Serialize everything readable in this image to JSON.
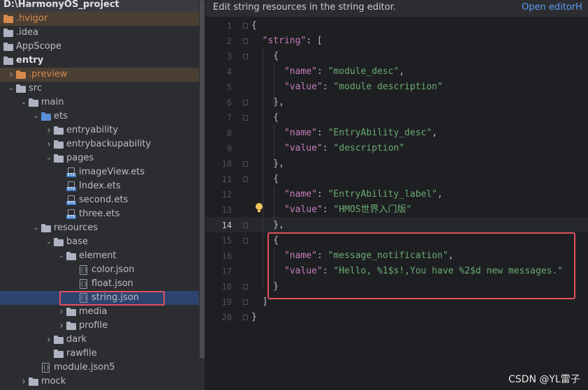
{
  "tree": {
    "project_root": "D:\\HarmonyOS_project",
    "items": [
      {
        "label": "D:\\HarmonyOS_project",
        "depth": 0,
        "kind": "root",
        "chev": ""
      },
      {
        "label": ".hvigor",
        "depth": 0,
        "kind": "folder",
        "chev": ""
      },
      {
        "label": ".idea",
        "depth": 0,
        "kind": "folder",
        "chev": ""
      },
      {
        "label": "AppScope",
        "depth": 0,
        "kind": "folder",
        "chev": ""
      },
      {
        "label": "entry",
        "depth": 0,
        "kind": "folder",
        "chev": ""
      },
      {
        "label": ".preview",
        "depth": 1,
        "kind": "folder",
        "chev": "right"
      },
      {
        "label": "src",
        "depth": 1,
        "kind": "folder",
        "chev": "down"
      },
      {
        "label": "main",
        "depth": 2,
        "kind": "folder",
        "chev": "down"
      },
      {
        "label": "ets",
        "depth": 3,
        "kind": "folder",
        "chev": "down"
      },
      {
        "label": "entryability",
        "depth": 4,
        "kind": "folder",
        "chev": "right"
      },
      {
        "label": "entrybackupability",
        "depth": 4,
        "kind": "folder",
        "chev": "right"
      },
      {
        "label": "pages",
        "depth": 4,
        "kind": "folder",
        "chev": "down"
      },
      {
        "label": "imageView.ets",
        "depth": 5,
        "kind": "ets",
        "chev": ""
      },
      {
        "label": "Index.ets",
        "depth": 5,
        "kind": "ets",
        "chev": ""
      },
      {
        "label": "second.ets",
        "depth": 5,
        "kind": "ets",
        "chev": ""
      },
      {
        "label": "three.ets",
        "depth": 5,
        "kind": "ets",
        "chev": ""
      },
      {
        "label": "resources",
        "depth": 3,
        "kind": "folder",
        "chev": "down"
      },
      {
        "label": "base",
        "depth": 4,
        "kind": "folder",
        "chev": "down"
      },
      {
        "label": "element",
        "depth": 5,
        "kind": "folder",
        "chev": "down"
      },
      {
        "label": "color.json",
        "depth": 6,
        "kind": "json",
        "chev": ""
      },
      {
        "label": "float.json",
        "depth": 6,
        "kind": "json",
        "chev": ""
      },
      {
        "label": "string.json",
        "depth": 6,
        "kind": "json",
        "chev": ""
      },
      {
        "label": "media",
        "depth": 5,
        "kind": "folder",
        "chev": "right"
      },
      {
        "label": "profile",
        "depth": 5,
        "kind": "folder",
        "chev": "right"
      },
      {
        "label": "dark",
        "depth": 4,
        "kind": "folder",
        "chev": "right"
      },
      {
        "label": "rawfile",
        "depth": 4,
        "kind": "folder",
        "chev": ""
      },
      {
        "label": "module.json5",
        "depth": 3,
        "kind": "json",
        "chev": ""
      },
      {
        "label": "mock",
        "depth": 2,
        "kind": "folder",
        "chev": "right"
      }
    ]
  },
  "banner": {
    "text": "Edit string resources in the string editor.",
    "open_editor": "Open editor",
    "hide": "H"
  },
  "editor": {
    "current_line": 14,
    "line_numbers": [
      "1",
      "2",
      "3",
      "4",
      "5",
      "6",
      "7",
      "8",
      "9",
      "10",
      "11",
      "12",
      "13",
      "14",
      "15",
      "16",
      "17",
      "18",
      "19",
      "20"
    ],
    "lines": [
      [
        [
          "p",
          "{"
        ]
      ],
      [
        [
          "p",
          "  "
        ],
        [
          "k",
          "\"string\""
        ],
        [
          "p",
          ": ["
        ]
      ],
      [
        [
          "p",
          "    {"
        ]
      ],
      [
        [
          "p",
          "      "
        ],
        [
          "k",
          "\"name\""
        ],
        [
          "p",
          ": "
        ],
        [
          "s",
          "\"module_desc\""
        ],
        [
          "p",
          ","
        ]
      ],
      [
        [
          "p",
          "      "
        ],
        [
          "k",
          "\"value\""
        ],
        [
          "p",
          ": "
        ],
        [
          "s",
          "\"module description\""
        ]
      ],
      [
        [
          "p",
          "    },"
        ]
      ],
      [
        [
          "p",
          "    {"
        ]
      ],
      [
        [
          "p",
          "      "
        ],
        [
          "k",
          "\"name\""
        ],
        [
          "p",
          ": "
        ],
        [
          "s",
          "\"EntryAbility_desc\""
        ],
        [
          "p",
          ","
        ]
      ],
      [
        [
          "p",
          "      "
        ],
        [
          "k",
          "\"value\""
        ],
        [
          "p",
          ": "
        ],
        [
          "s",
          "\"description\""
        ]
      ],
      [
        [
          "p",
          "    },"
        ]
      ],
      [
        [
          "p",
          "    {"
        ]
      ],
      [
        [
          "p",
          "      "
        ],
        [
          "k",
          "\"name\""
        ],
        [
          "p",
          ": "
        ],
        [
          "s",
          "\"EntryAbility_label\""
        ],
        [
          "p",
          ","
        ]
      ],
      [
        [
          "p",
          "      "
        ],
        [
          "k",
          "\"value\""
        ],
        [
          "p",
          ": "
        ],
        [
          "s",
          "\"HMOS世界入门版\""
        ]
      ],
      [
        [
          "p",
          "    },"
        ]
      ],
      [
        [
          "p",
          "    {"
        ]
      ],
      [
        [
          "p",
          "      "
        ],
        [
          "k",
          "\"name\""
        ],
        [
          "p",
          ": "
        ],
        [
          "s",
          "\"message_notification\""
        ],
        [
          "p",
          ","
        ]
      ],
      [
        [
          "p",
          "      "
        ],
        [
          "k",
          "\"value\""
        ],
        [
          "p",
          ": "
        ],
        [
          "s",
          "\"Hello, %1$s!,You have %2$d new messages.\""
        ]
      ],
      [
        [
          "p",
          "    }"
        ]
      ],
      [
        [
          "p",
          "  ]"
        ]
      ],
      [
        [
          "p",
          "}"
        ]
      ]
    ]
  },
  "watermark": "CSDN @YL雷子",
  "colors": {
    "keyword": "#c77dbb",
    "string": "#6aab73",
    "highlight_box": "#e0505f",
    "link": "#5c9cf5"
  }
}
